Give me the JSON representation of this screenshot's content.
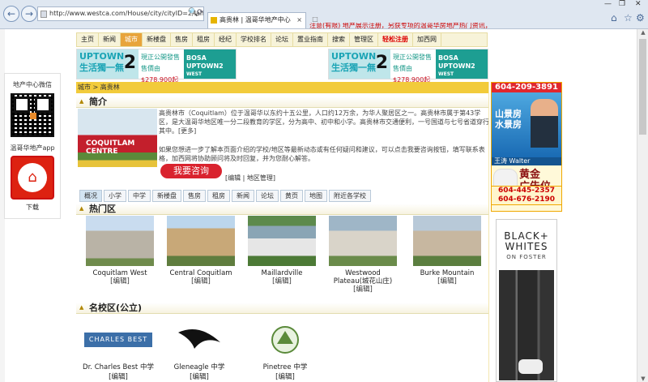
{
  "browser": {
    "back_glyph": "←",
    "forward_glyph": "→",
    "url": "http://www.westca.com/House/city/cityID=2/lang",
    "addr_search": "🔍",
    "addr_refresh": "⟳",
    "tab_title": "高贵林 | 温哥华地产中心",
    "tab_close": "×",
    "new_tab": "□",
    "win_min": "—",
    "win_max": "❐",
    "win_close": "✕",
    "home": "⌂",
    "star": "☆",
    "gear": "⚙"
  },
  "marquee": "注意(有限) 地产展示注册，另获专项的温哥华房地产热门资讯，注册即送",
  "site_nav": [
    "主页",
    "新闻",
    "城市",
    "新楼盘",
    "售房",
    "租房",
    "经纪",
    "学校排名",
    "论坛",
    "置业指南",
    "搜索",
    "管理区",
    "轻松注册",
    "加西网"
  ],
  "site_nav_active": "城市",
  "site_nav_register": "轻松注册",
  "banner": {
    "title1": "UPTOWN",
    "title2": "生活獨一無",
    "num": "2",
    "pub1": "現正公開發售",
    "pub2": "售價由",
    "price": "$278,900起",
    "brand1": "BOSA",
    "brand2": "UPTOWN2",
    "brand3": "WEST COQUITLAM"
  },
  "breadcrumb": {
    "a": "城市",
    "sep": " > ",
    "b": "高贵林"
  },
  "left_box": {
    "wechat": "地产中心微信",
    "app": "温哥华地产app",
    "download": "下载",
    "app_glyph": "⌂"
  },
  "intro": {
    "heading": "简介",
    "arrow": "▲",
    "img_sign": "COQUITLAM CENTRE",
    "text1": "高贵林市（Coquitlam）位于温哥华以东约十五公里，人口约12万余，为华人聚居区之一。高贵林市属于第43学区，是大温哥华地区唯一分二段教育的学区，分为高中、初中和小学。高贵林市交通便利，一号国道与七号省道穿行其中。[更多]",
    "text2": "如果您想进一步了解本页面介绍的学校/地区等最新动态或有任何疑问和建议，可以点击我要咨询按钮，填写联系表格，加西网将协助顾问将及时回复，并为您耐心解答。",
    "ask_btn": "我要咨询",
    "edit": "[编辑 | 地区管理]"
  },
  "sub_tabs": [
    "概况",
    "小学",
    "中学",
    "新楼盘",
    "售房",
    "租房",
    "新闻",
    "论坛",
    "黄页",
    "地图",
    "附近各学校"
  ],
  "sub_tab_active": "概况",
  "hot": {
    "heading": "热门区",
    "arrow": "▲",
    "items": [
      {
        "name": "Coquitlam West",
        "edit": "[编辑]"
      },
      {
        "name": "Central Coquitlam",
        "edit": "[编辑]"
      },
      {
        "name": "Maillardville",
        "edit": "[编辑]"
      },
      {
        "name": "Westwood Plateau(城花山庄)",
        "edit": "[编辑]"
      },
      {
        "name": "Burke Mountain",
        "edit": "[编辑]"
      }
    ]
  },
  "schools": {
    "heading": "名校区(公立)",
    "arrow": "▲",
    "items": [
      {
        "name": "Dr. Charles Best 中学",
        "logo": "CHARLES BEST",
        "edit": "[编辑]"
      },
      {
        "name": "Gleneagle 中学",
        "logo": "",
        "edit": "[编辑]"
      },
      {
        "name": "Pinetree 中学",
        "logo": "",
        "edit": "[编辑]"
      }
    ]
  },
  "right_ad": {
    "phone": "604-209-3891",
    "line1": "山景房",
    "line2": "水景房",
    "agent": "王涛 Walter",
    "gold1": "黄金",
    "gold2": "广告位",
    "phone2": "604-445-2357",
    "phone3": "604-676-2190"
  },
  "right_ad2": {
    "l1": "BLACK+",
    "l2": "WHITES",
    "l3": "ON FOSTER"
  },
  "scroll": {
    "up": "▲",
    "down": "▼"
  },
  "colors": {
    "nav_active": "#e8a43b",
    "crumb": "#f2cb3b",
    "accent_red": "#d9232e",
    "teal": "#1d9e92"
  }
}
